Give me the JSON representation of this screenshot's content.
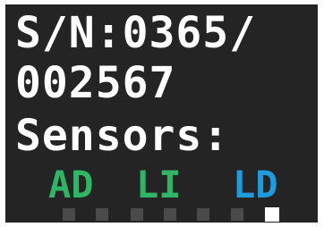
{
  "display": {
    "serial_label_line": "S/N:0365/",
    "serial_number_line": "002567",
    "sensors_heading": "Sensors:"
  },
  "sensors": [
    {
      "label": "AD",
      "color": "#2fb565"
    },
    {
      "label": "LI",
      "color": "#2fb565"
    },
    {
      "label": "LD",
      "color": "#1e9bdc"
    }
  ],
  "pager": {
    "page_count": 7,
    "active_page": 6,
    "active_color": "#ffffff",
    "inactive_color": "#4a4a4a"
  },
  "colors": {
    "screen_background": "#242424",
    "text": "#ffffff"
  }
}
